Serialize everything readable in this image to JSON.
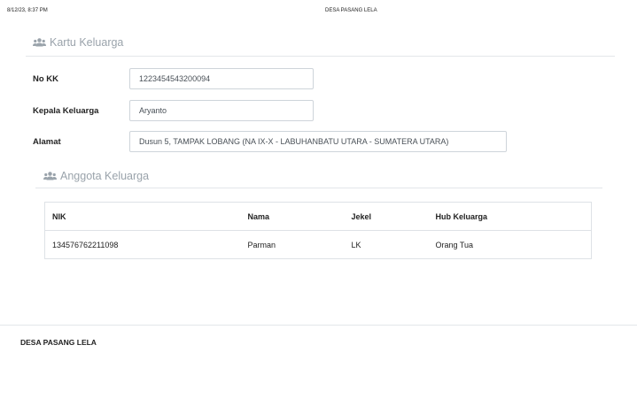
{
  "print_header": {
    "datetime": "8/12/23, 8:37 PM",
    "title": "DESA PASANG LELA"
  },
  "kartu_keluarga": {
    "heading": "Kartu Keluarga",
    "icon": "users-icon",
    "fields": {
      "no_kk": {
        "label": "No KK",
        "value": "1223454543200094"
      },
      "kepala_keluarga": {
        "label": "Kepala Keluarga",
        "value": "Aryanto"
      },
      "alamat": {
        "label": "Alamat",
        "value": "Dusun 5, TAMPAK LOBANG (NA IX-X - LABUHANBATU UTARA - SUMATERA UTARA)"
      }
    }
  },
  "anggota_keluarga": {
    "heading": "Anggota Keluarga",
    "icon": "users-icon",
    "columns": [
      "NIK",
      "Nama",
      "Jekel",
      "Hub Keluarga"
    ],
    "rows": [
      [
        "134576762211098",
        "Parman",
        "LK",
        "Orang Tua"
      ]
    ]
  },
  "footer": {
    "text": "DESA PASANG LELA"
  },
  "colors": {
    "muted_heading": "#9aa3ab",
    "border": "#dee2e6"
  }
}
